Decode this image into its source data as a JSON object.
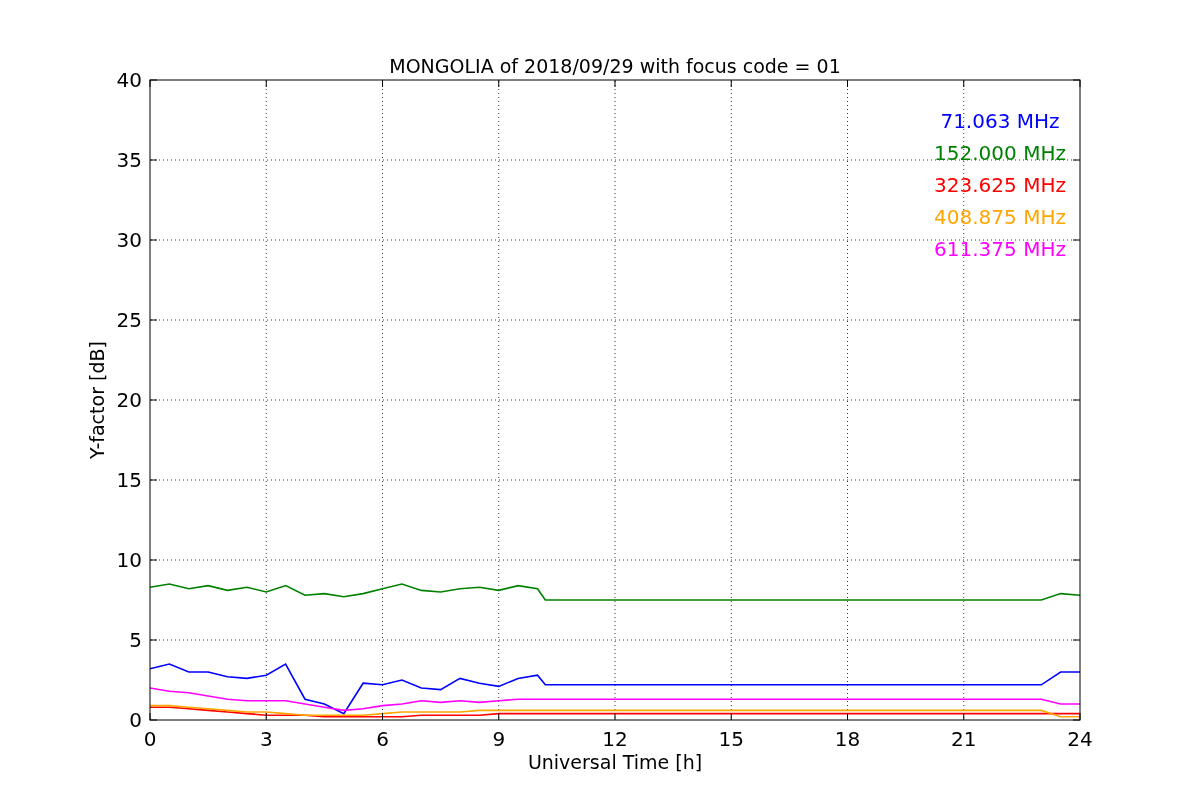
{
  "figure": {
    "chart_data": {
      "type": "line",
      "title": "MONGOLIA of 2018/09/29 with focus code = 01",
      "xlabel": "Universal Time [h]",
      "ylabel": "Y-factor [dB]",
      "x": [
        0,
        0.5,
        1,
        1.5,
        2,
        2.5,
        3,
        3.5,
        4,
        4.5,
        5,
        5.5,
        6,
        6.5,
        7,
        7.5,
        8,
        8.5,
        9,
        9.5,
        10,
        10.2,
        23,
        23.5,
        24
      ],
      "series": [
        {
          "name": "71.063 MHz",
          "color": "#0000ff",
          "values": [
            3.2,
            3.5,
            3.0,
            3.0,
            2.7,
            2.6,
            2.8,
            3.5,
            1.3,
            1.0,
            0.4,
            2.3,
            2.2,
            2.5,
            2.0,
            1.9,
            2.6,
            2.3,
            2.1,
            2.6,
            2.8,
            2.2,
            2.2,
            3.0,
            3.0
          ]
        },
        {
          "name": "152.000 MHz",
          "color": "#008000",
          "values": [
            8.3,
            8.5,
            8.2,
            8.4,
            8.1,
            8.3,
            8.0,
            8.4,
            7.8,
            7.9,
            7.7,
            7.9,
            8.2,
            8.5,
            8.1,
            8.0,
            8.2,
            8.3,
            8.1,
            8.4,
            8.2,
            7.5,
            7.5,
            7.9,
            7.8
          ]
        },
        {
          "name": "323.625 MHz",
          "color": "#ff0000",
          "values": [
            0.8,
            0.8,
            0.7,
            0.6,
            0.5,
            0.4,
            0.3,
            0.3,
            0.3,
            0.2,
            0.2,
            0.2,
            0.2,
            0.2,
            0.3,
            0.3,
            0.3,
            0.3,
            0.4,
            0.4,
            0.4,
            0.4,
            0.4,
            0.4,
            0.4
          ]
        },
        {
          "name": "408.875 MHz",
          "color": "#ffa500",
          "values": [
            0.9,
            0.9,
            0.8,
            0.7,
            0.6,
            0.5,
            0.5,
            0.4,
            0.3,
            0.3,
            0.3,
            0.3,
            0.4,
            0.5,
            0.5,
            0.5,
            0.5,
            0.6,
            0.6,
            0.6,
            0.6,
            0.6,
            0.6,
            0.2,
            0.2
          ]
        },
        {
          "name": "611.375 MHz",
          "color": "#ff00ff",
          "values": [
            2.0,
            1.8,
            1.7,
            1.5,
            1.3,
            1.2,
            1.2,
            1.2,
            1.0,
            0.8,
            0.6,
            0.7,
            0.9,
            1.0,
            1.2,
            1.1,
            1.2,
            1.1,
            1.2,
            1.3,
            1.3,
            1.3,
            1.3,
            1.0,
            1.0
          ]
        }
      ],
      "xlim": [
        0,
        24
      ],
      "ylim": [
        0,
        40
      ],
      "xticks": [
        0,
        3,
        6,
        9,
        12,
        15,
        18,
        21,
        24
      ],
      "yticks": [
        0,
        5,
        10,
        15,
        20,
        25,
        30,
        35,
        40
      ],
      "grid": true
    }
  }
}
